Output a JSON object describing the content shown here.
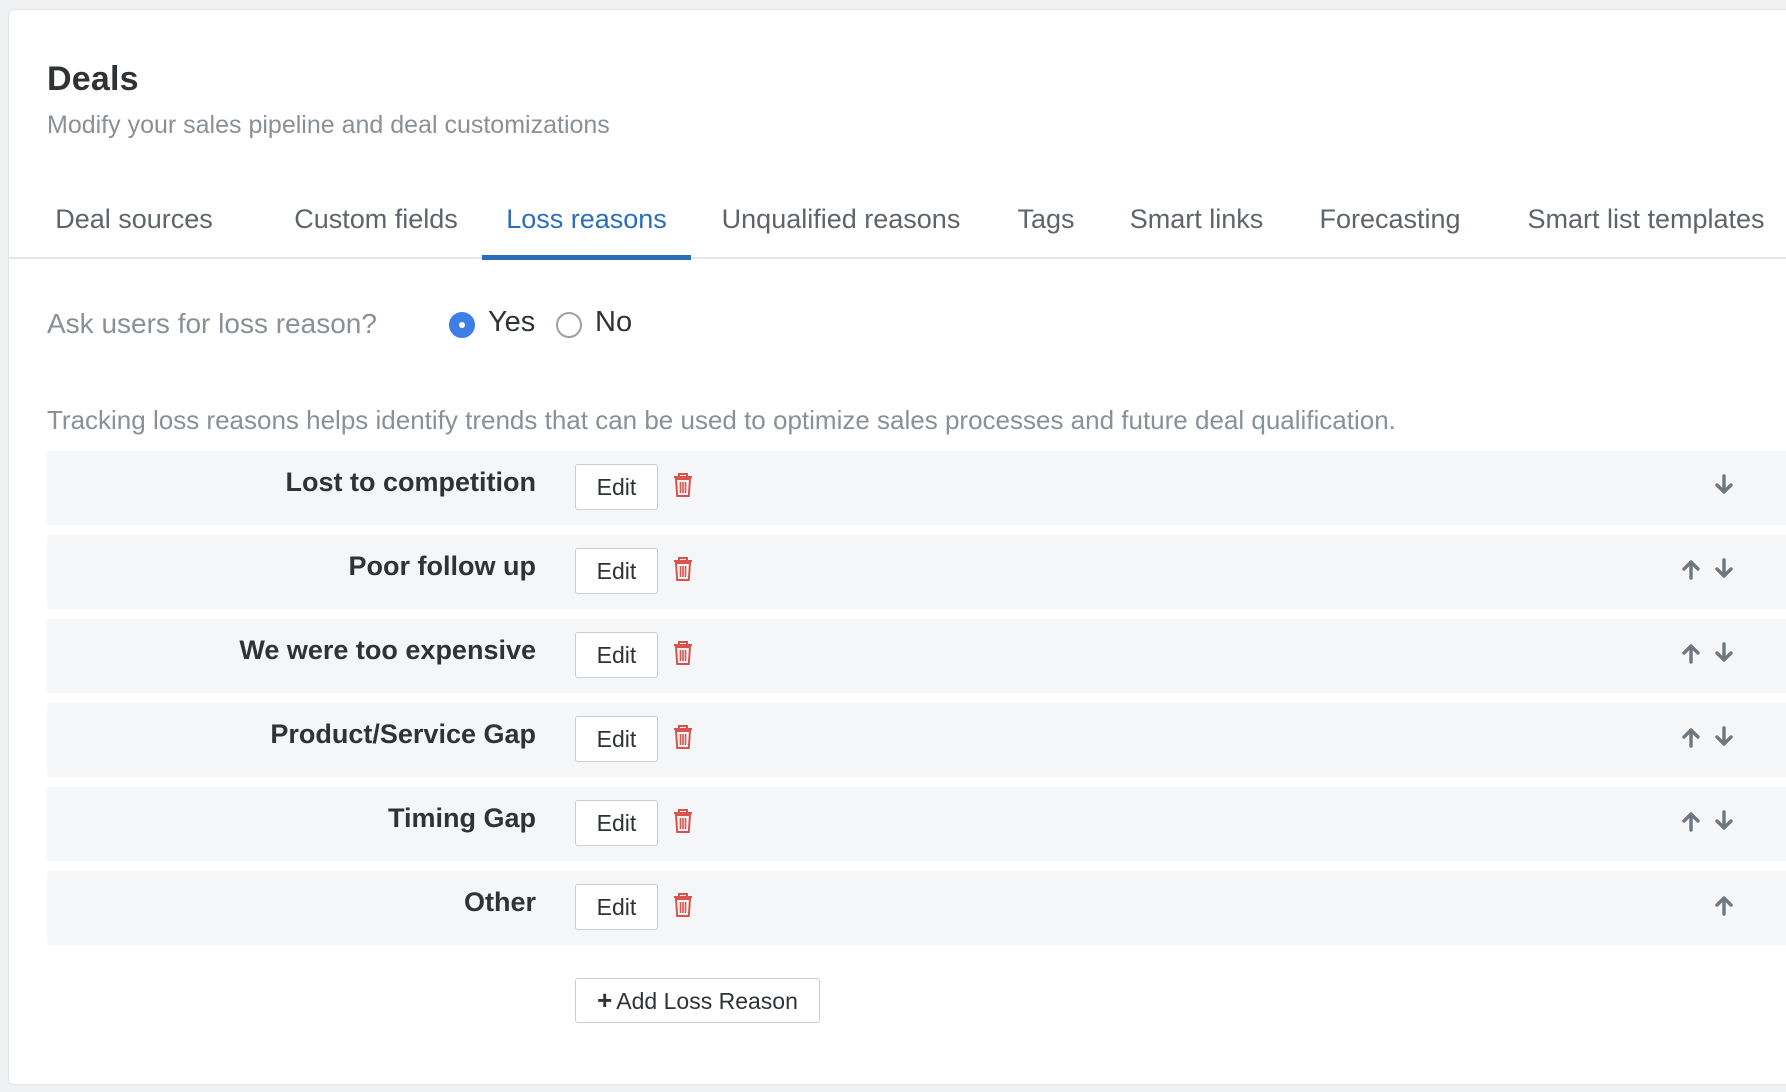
{
  "header": {
    "title": "Deals",
    "subtitle": "Modify your sales pipeline and deal customizations"
  },
  "tabs": [
    {
      "label": "Deal sources",
      "active": false
    },
    {
      "label": "Custom fields",
      "active": false
    },
    {
      "label": "Loss reasons",
      "active": true
    },
    {
      "label": "Unqualified reasons",
      "active": false
    },
    {
      "label": "Tags",
      "active": false
    },
    {
      "label": "Smart links",
      "active": false
    },
    {
      "label": "Forecasting",
      "active": false
    },
    {
      "label": "Smart list templates",
      "active": false
    }
  ],
  "ask_loss_reason": {
    "question": "Ask users for loss reason?",
    "options": [
      {
        "label": "Yes",
        "selected": true
      },
      {
        "label": "No",
        "selected": false
      }
    ]
  },
  "help_text": "Tracking loss reasons helps identify trends that can be used to optimize sales processes and future deal qualification.",
  "reasons": [
    {
      "name": "Lost to competition",
      "edit_label": "Edit",
      "can_move_up": false,
      "can_move_down": true
    },
    {
      "name": "Poor follow up",
      "edit_label": "Edit",
      "can_move_up": true,
      "can_move_down": true
    },
    {
      "name": "We were too expensive",
      "edit_label": "Edit",
      "can_move_up": true,
      "can_move_down": true
    },
    {
      "name": "Product/Service Gap",
      "edit_label": "Edit",
      "can_move_up": true,
      "can_move_down": true
    },
    {
      "name": "Timing Gap",
      "edit_label": "Edit",
      "can_move_up": true,
      "can_move_down": true
    },
    {
      "name": "Other",
      "edit_label": "Edit",
      "can_move_up": true,
      "can_move_down": false
    }
  ],
  "add_button": {
    "label": "Add Loss Reason",
    "icon": "plus-icon"
  },
  "colors": {
    "accent": "#2a6ebb",
    "radio_selected": "#3d7fe6",
    "delete": "#d9534f",
    "row_background": "#f4f6f8",
    "arrow": "#6f777e"
  }
}
